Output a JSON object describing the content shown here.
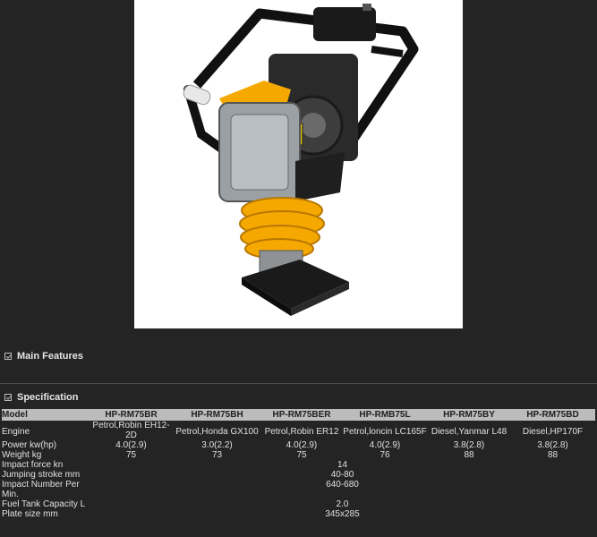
{
  "product_image": {
    "alt": "Tamping rammer"
  },
  "sections": {
    "main_features": "Main Features",
    "specification": "Specification"
  },
  "spec": {
    "header": [
      "Model",
      "HP-RM75BR",
      "HP-RM75BH",
      "HP-RM75BER",
      "HP-RMB75L",
      "HP-RM75BY",
      "HP-RM75BD"
    ],
    "rows": [
      {
        "label": "Engine",
        "values": [
          "Petrol,Robin EH12-2D",
          "Petrol,Honda GX100",
          "Petrol,Robin ER12",
          "Petrol,loncin LC165F",
          "Diesel,Yanmar L48",
          "Diesel,HP170F"
        ]
      },
      {
        "label": "Power kw(hp)",
        "values": [
          "4.0(2.9)",
          "3.0(2.2)",
          "4.0(2.9)",
          "4.0(2.9)",
          "3.8(2.8)",
          "3.8(2.8)"
        ]
      },
      {
        "label": "Weight kg",
        "values": [
          "75",
          "73",
          "75",
          "76",
          "88",
          "88"
        ]
      }
    ],
    "common_rows": [
      {
        "label": "Impact force kn",
        "value": "14"
      },
      {
        "label": "Jumping stroke mm",
        "value": "40-80"
      },
      {
        "label": "Impact Number Per Min.",
        "value": "640-680"
      },
      {
        "label": "Fuel Tank Capacity L",
        "value": "2.0"
      },
      {
        "label": "Plate size mm",
        "value": "345x285"
      }
    ]
  },
  "colors": {
    "background": "#242424",
    "header_bar": "#bcbcbc",
    "machine_yellow": "#f5a800",
    "machine_black": "#1a1a1a"
  }
}
